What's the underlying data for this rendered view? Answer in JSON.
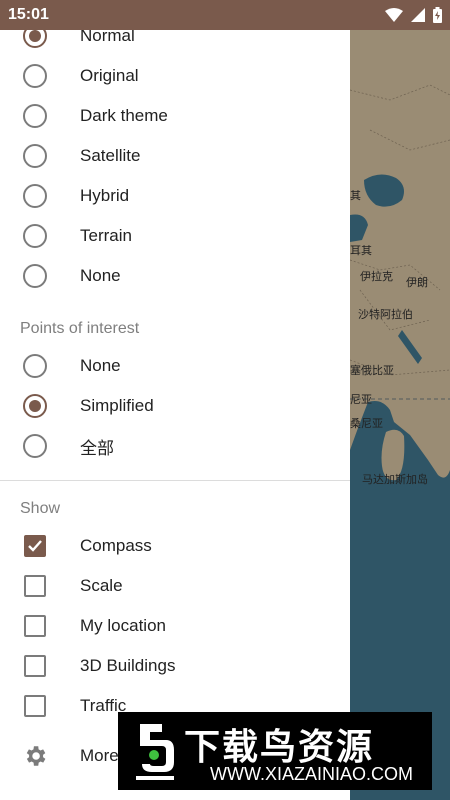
{
  "status_bar": {
    "time": "15:01"
  },
  "map_type": {
    "options": [
      "Normal",
      "Original",
      "Dark theme",
      "Satellite",
      "Hybrid",
      "Terrain",
      "None"
    ],
    "selected": "Normal"
  },
  "poi": {
    "title": "Points of interest",
    "options": [
      "None",
      "Simplified",
      "全部"
    ],
    "selected": "Simplified"
  },
  "show": {
    "title": "Show",
    "options": [
      {
        "label": "Compass",
        "checked": true
      },
      {
        "label": "Scale",
        "checked": false
      },
      {
        "label": "My location",
        "checked": false
      },
      {
        "label": "3D Buildings",
        "checked": false
      },
      {
        "label": "Traffic",
        "checked": false
      }
    ]
  },
  "more": {
    "label": "More"
  },
  "map_labels": [
    "其",
    "耳其",
    "伊拉克",
    "伊朗",
    "沙特阿拉伯",
    "塞俄比亚",
    "尼亚",
    "桑尼亚",
    "马达加斯加岛"
  ],
  "watermark": {
    "title": "下载鸟资源",
    "url": "WWW.XIAZAINIAO.COM"
  },
  "colors": {
    "accent": "#7a5a4c",
    "map_water": "#2f5566",
    "map_land": "#9a8c74"
  }
}
